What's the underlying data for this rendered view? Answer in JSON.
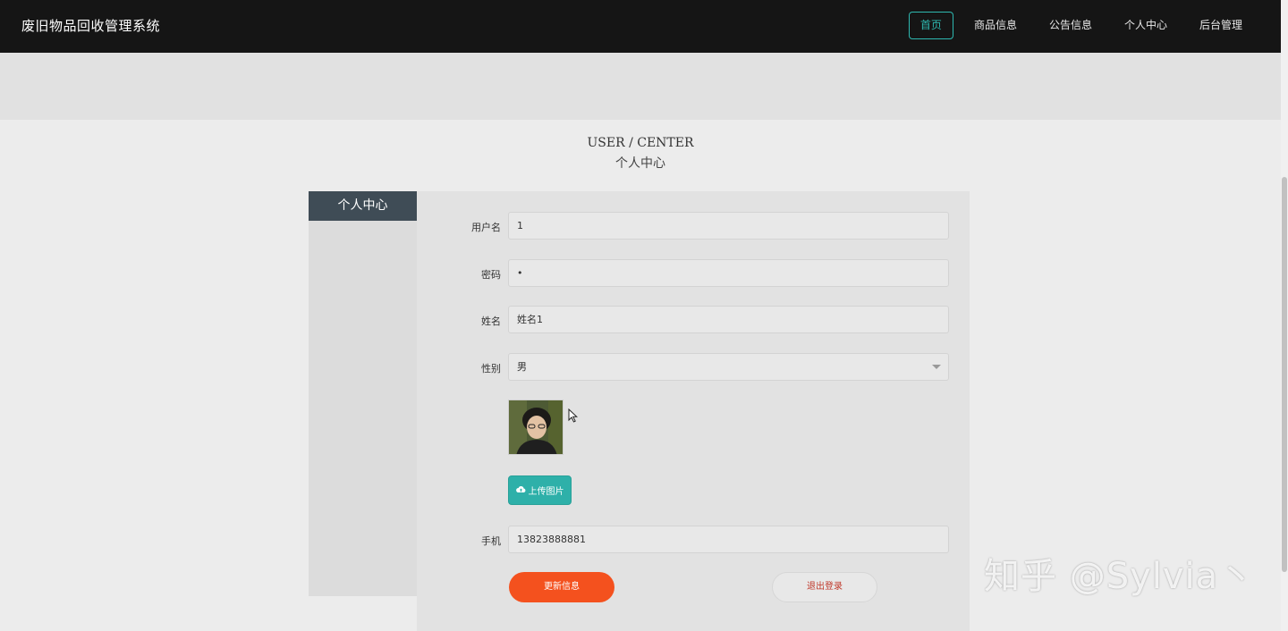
{
  "app": {
    "title": "废旧物品回收管理系统"
  },
  "nav": {
    "items": [
      {
        "label": "首页",
        "active": true
      },
      {
        "label": "商品信息",
        "active": false
      },
      {
        "label": "公告信息",
        "active": false
      },
      {
        "label": "个人中心",
        "active": false
      },
      {
        "label": "后台管理",
        "active": false
      }
    ]
  },
  "page": {
    "title_en": "USER / CENTER",
    "title_zh": "个人中心"
  },
  "sidebar": {
    "header": "个人中心"
  },
  "form": {
    "username": {
      "label": "用户名",
      "value": "1"
    },
    "password": {
      "label": "密码",
      "value": "•"
    },
    "name": {
      "label": "姓名",
      "value": "姓名1"
    },
    "gender": {
      "label": "性别",
      "value": "男"
    },
    "upload_label": "上传图片",
    "phone": {
      "label": "手机",
      "value": "13823888881"
    },
    "update_button": "更新信息",
    "logout_button": "退出登录"
  },
  "watermark": "知乎 @Sylvia丶",
  "colors": {
    "accent": "#2eb0a9",
    "primary_button": "#f4511e",
    "logout_text": "#c0392b",
    "topbar": "#151515",
    "sidebar_head": "#3f4c56"
  }
}
